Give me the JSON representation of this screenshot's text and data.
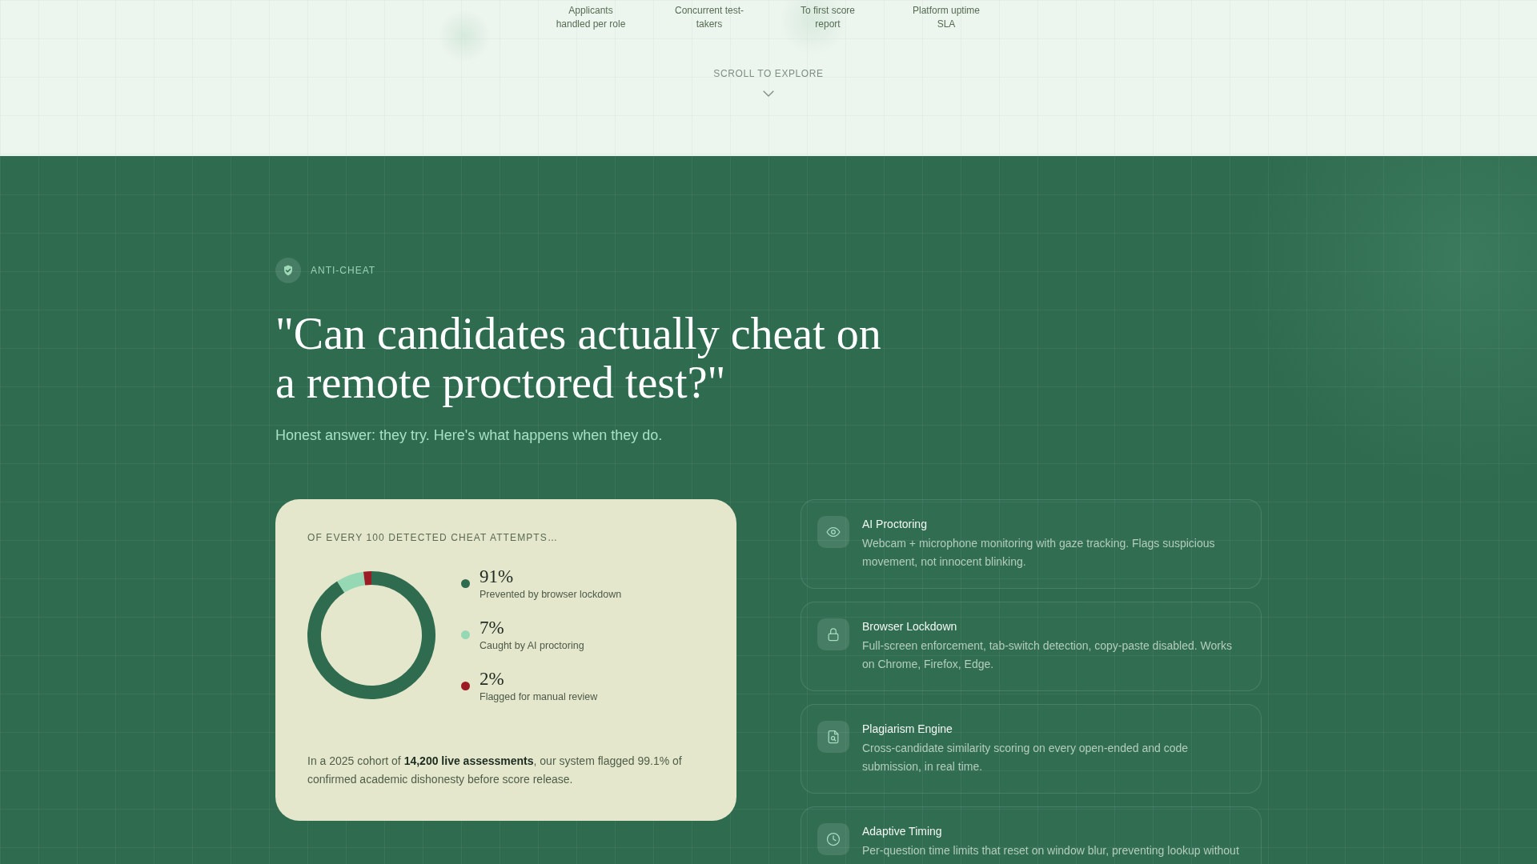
{
  "hero_stats": [
    {
      "label": "Applicants handled per role"
    },
    {
      "label": "Concurrent test-takers"
    },
    {
      "label": "To first score report"
    },
    {
      "label": "Platform uptime SLA"
    }
  ],
  "scroll_hint": "SCROLL TO EXPLORE",
  "section": {
    "eyebrow": "ANTI-CHEAT",
    "title": "\"Can candidates actually cheat on a remote proctored test?\"",
    "subtitle": "Honest answer: they try. Here's what happens when they do."
  },
  "breakdown_card": {
    "title": "OF EVERY 100 DETECTED CHEAT ATTEMPTS…",
    "chart_data": {
      "type": "donut",
      "values": [
        91,
        7,
        2
      ],
      "colors": [
        "#2e6b4f",
        "#97d8b4",
        "#9b1c24"
      ]
    },
    "legend": [
      {
        "value": "91%",
        "label": "Prevented by browser lockdown",
        "color": "#2e6b4f"
      },
      {
        "value": "7%",
        "label": "Caught by AI proctoring",
        "color": "#97d8b4"
      },
      {
        "value": "2%",
        "label": "Flagged for manual review",
        "color": "#9b1c24"
      }
    ],
    "note": "In a 2025 cohort of **14,200 live assessments**, our system flagged 99.1% of confirmed academic dishonesty before score release."
  },
  "features": [
    {
      "title": "AI Proctoring",
      "description": "Webcam + microphone monitoring with gaze tracking. Flags suspicious movement, not innocent blinking."
    },
    {
      "title": "Browser Lockdown",
      "description": "Full-screen enforcement, tab-switch detection, copy-paste disabled. Works on Chrome, Firefox, Edge."
    },
    {
      "title": "Plagiarism Engine",
      "description": "Cross-candidate similarity scoring on every open-ended and code submission, in real time."
    },
    {
      "title": "Adaptive Timing",
      "description": "Per-question time limits that reset on window blur, preventing lookup without"
    }
  ]
}
